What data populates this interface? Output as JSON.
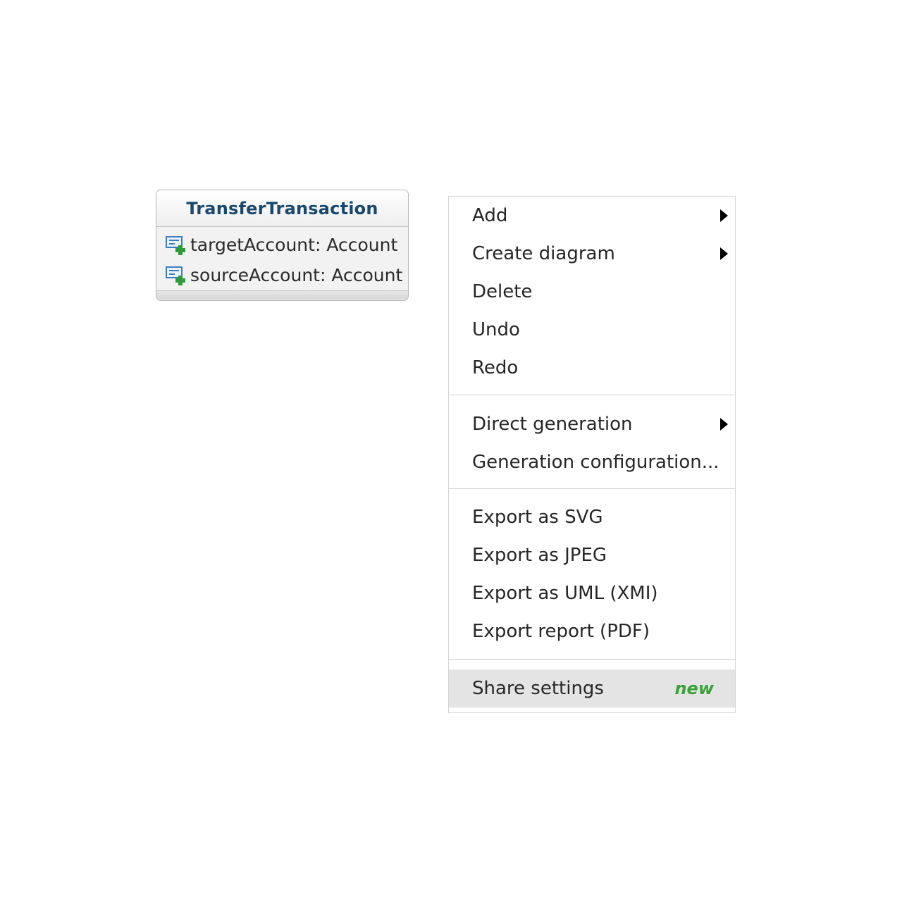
{
  "uml_class": {
    "name": "TransferTransaction",
    "attributes": [
      {
        "label": "targetAccount: Account",
        "icon": "attribute-add-icon"
      },
      {
        "label": "sourceAccount: Account",
        "icon": "attribute-add-icon"
      }
    ]
  },
  "context_menu": {
    "sections": [
      [
        {
          "label": "Add",
          "submenu": true
        },
        {
          "label": "Create diagram",
          "submenu": true
        },
        {
          "label": "Delete",
          "submenu": false
        },
        {
          "label": "Undo",
          "submenu": false
        },
        {
          "label": "Redo",
          "submenu": false
        }
      ],
      [
        {
          "label": "Direct generation",
          "submenu": true
        },
        {
          "label": "Generation configuration...",
          "submenu": false
        }
      ],
      [
        {
          "label": "Export as SVG",
          "submenu": false
        },
        {
          "label": "Export as JPEG",
          "submenu": false
        },
        {
          "label": "Export as UML (XMI)",
          "submenu": false
        },
        {
          "label": "Export report (PDF)",
          "submenu": false
        }
      ],
      [
        {
          "label": "Share settings",
          "submenu": false,
          "badge": "new",
          "highlighted": true
        }
      ]
    ]
  },
  "colors": {
    "class_name": "#1a4870",
    "badge_new": "#3aa23a",
    "highlight": "#e4e4e4"
  }
}
